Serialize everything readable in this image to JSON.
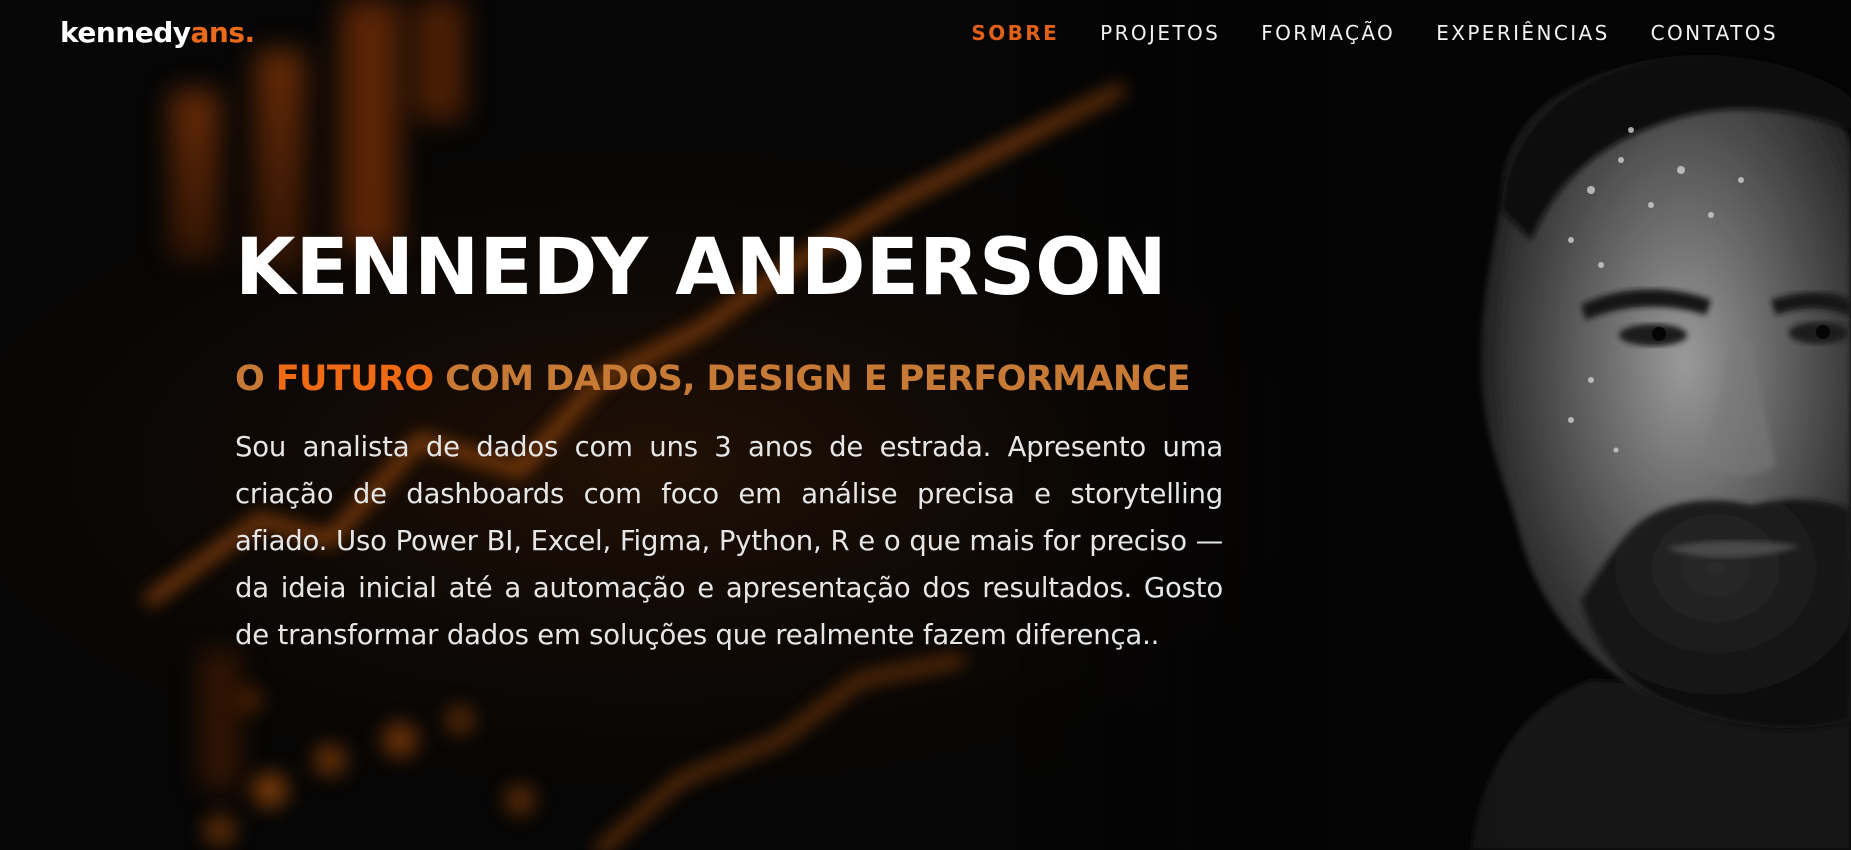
{
  "nav": {
    "logo_main": "kennedy",
    "logo_accent": "ans.",
    "items": [
      {
        "label": "SOBRE",
        "active": true
      },
      {
        "label": "PROJETOS",
        "active": false
      },
      {
        "label": "FORMAÇÃO",
        "active": false
      },
      {
        "label": "EXPERIÊNCIAS",
        "active": false
      },
      {
        "label": "CONTATOS",
        "active": false
      }
    ]
  },
  "hero": {
    "name": "KENNEDY ANDERSON",
    "tagline_part1": "O ",
    "tagline_highlight": "FUTURO",
    "tagline_part2": " COM DADOS, DESIGN E PERFORMANCE",
    "bio": "Sou analista de dados com uns 3 anos de estrada. Apresento uma criação de dashboards com foco em análise precisa e storytelling afiado. Uso Power BI, Excel, Figma, Python, R e o que mais for preciso — da ideia inicial até a automação e apresentação dos resultados. Gosto de transformar dados em soluções que realmente fazem diferença.."
  },
  "colors": {
    "accent": "#ea6a1b",
    "tagline_muted": "#c77a35",
    "background": "#060606",
    "text": "#ffffff"
  }
}
